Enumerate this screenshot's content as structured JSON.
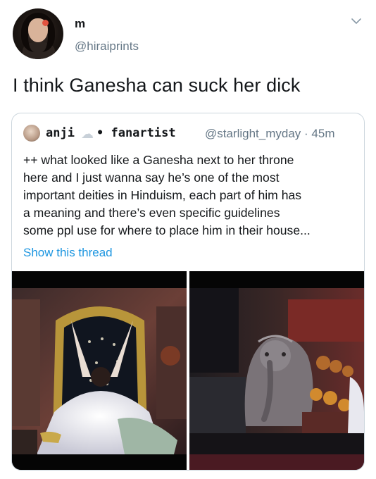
{
  "tweet": {
    "author_name": "m",
    "author_handle": "@hiraiprints",
    "text": "I think Ganesha can suck her dick"
  },
  "quoted_tweet": {
    "name_part1": "anji",
    "name_emoji": "☁",
    "name_part2": "• fanartist",
    "handle_time": "@starlight_myday · 45m",
    "lines": [
      "++ what looked like a Ganesha next to her throne",
      "here and I just wanna say he’s one of the most",
      "important deities in Hinduism, each part of him has",
      "a meaning and there’s even specific guidelines",
      "some ppl use for where to place him in their house..."
    ],
    "show_thread": "Show this thread"
  },
  "icons": {
    "menu": "chevron-down-icon",
    "cloud": "cloud-icon"
  },
  "colors": {
    "link": "#1b95e0",
    "secondary_text": "#657786",
    "border": "#ccd6dd"
  }
}
